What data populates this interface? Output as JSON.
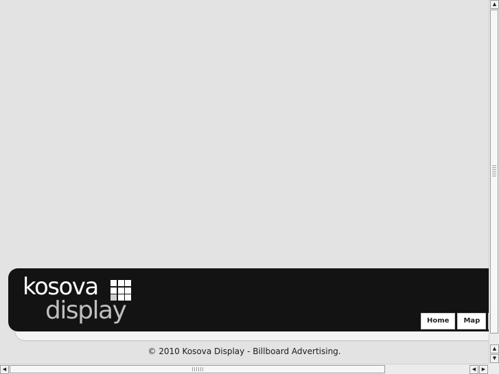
{
  "logo": {
    "word1": "kosova",
    "word2": "display",
    "grid_icon": "grid-squares-icon"
  },
  "nav": {
    "items": [
      {
        "label": "Home"
      },
      {
        "label": "Map"
      }
    ]
  },
  "footer": {
    "copyright": "© 2010 Kosova Display - Billboard Advertising."
  },
  "colors": {
    "page_background": "#e3e3e3",
    "banner": "#131313",
    "logo_primary": "#ffffff",
    "logo_secondary": "#bfbfbf",
    "nav_button": "#ffffff"
  },
  "scrollbars": {
    "up_icon": "arrow-up-icon",
    "down_icon": "arrow-down-icon",
    "left_icon": "arrow-left-icon",
    "right_icon": "arrow-right-icon"
  }
}
